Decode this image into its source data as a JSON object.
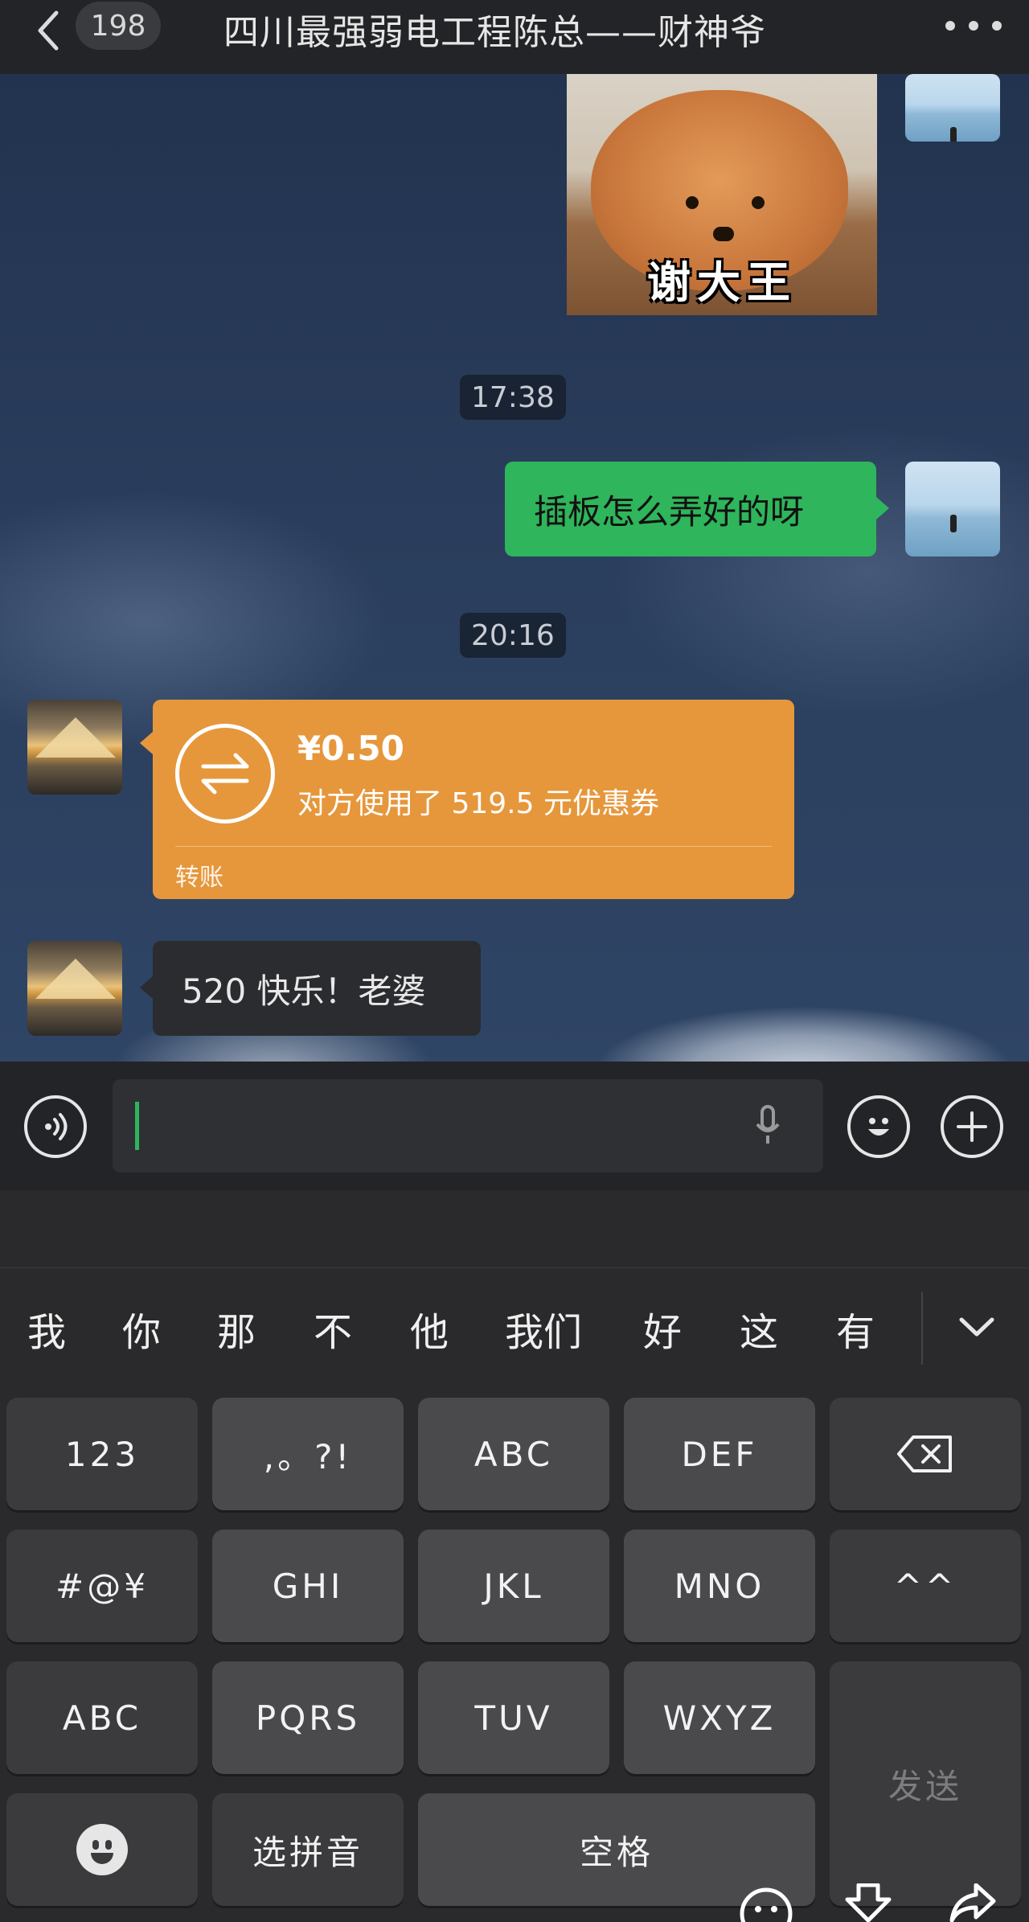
{
  "header": {
    "unread_count": "198",
    "title": "四川最强弱电工程陈总——财神爷"
  },
  "chat": {
    "sticker_caption": "谢大王",
    "messages": [
      {
        "type": "time",
        "text": "17:38"
      },
      {
        "type": "text",
        "sender": "me",
        "text": "插板怎么弄好的呀"
      },
      {
        "type": "time",
        "text": "20:16"
      },
      {
        "type": "transfer",
        "sender": "other",
        "amount": "¥0.50",
        "description": "对方使用了 519.5 元优惠券",
        "label": "转账"
      },
      {
        "type": "text",
        "sender": "other",
        "text": "520 快乐！老婆"
      }
    ]
  },
  "input": {
    "value": ""
  },
  "keyboard": {
    "candidates": [
      "我",
      "你",
      "那",
      "不",
      "他",
      "我们",
      "好",
      "这",
      "有"
    ],
    "rows": [
      [
        "123",
        ",。?!",
        "ABC",
        "DEF"
      ],
      [
        "#@¥",
        "GHI",
        "JKL",
        "MNO",
        "^^"
      ],
      [
        "ABC",
        "PQRS",
        "TUV",
        "WXYZ"
      ],
      [
        "选拼音",
        "空格"
      ]
    ],
    "send_label": "发送"
  },
  "colors": {
    "self_bubble": "#2fb55b",
    "transfer_card": "#e6973b",
    "other_bubble": "#2b2c2f",
    "header_bg": "#232427"
  }
}
